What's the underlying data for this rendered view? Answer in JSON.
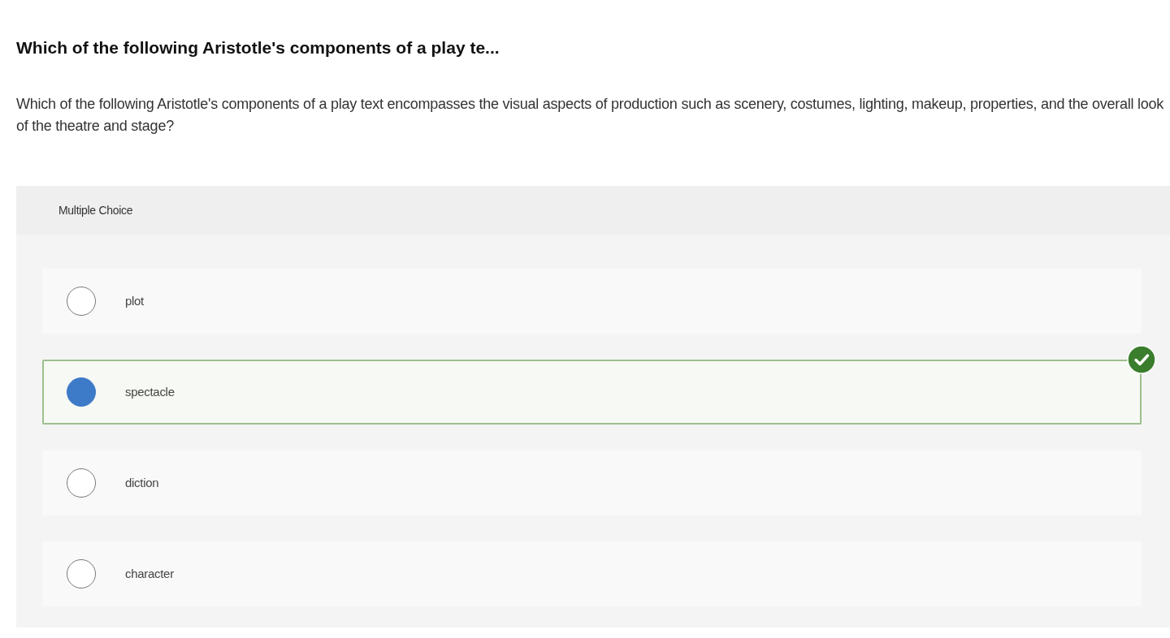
{
  "title": "Which of the following Aristotle's components of a play te...",
  "prompt": "Which of the following Aristotle's components of a play text encompasses the visual aspects of production such as scenery, costumes, lighting, makeup, properties, and the overall look of the theatre and stage?",
  "question_type": "Multiple Choice",
  "options": [
    {
      "label": "plot",
      "selected": false,
      "correct": false
    },
    {
      "label": "spectacle",
      "selected": true,
      "correct": true
    },
    {
      "label": "diction",
      "selected": false,
      "correct": false
    },
    {
      "label": "character",
      "selected": false,
      "correct": false
    }
  ]
}
